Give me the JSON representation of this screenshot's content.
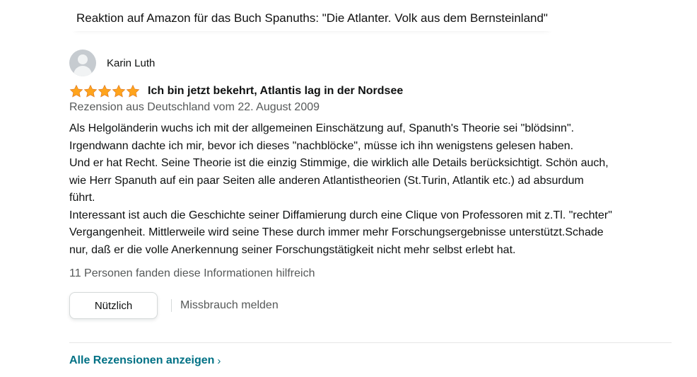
{
  "header": {
    "caption": "Reaktion auf Amazon für das Buch Spanuths: \"Die Atlanter. Volk aus dem Bernsteinland\""
  },
  "review": {
    "author": "Karin Luth",
    "rating": 5,
    "rating_max": 5,
    "star_color": "#ffa41c",
    "title": "Ich bin jetzt bekehrt, Atlantis lag in der Nordsee",
    "date_line": "Rezension aus Deutschland vom 22. August 2009",
    "body_lines": [
      "Als Helgoländerin wuchs ich mit der allgemeinen Einschätzung auf, Spanuth's Theorie sei \"blödsinn\".",
      "Irgendwann dachte ich mir, bevor ich dieses \"nachblöcke\", müsse ich ihn wenigstens gelesen haben.",
      "Und er hat Recht. Seine Theorie ist die einzig Stimmige, die wirklich alle Details berücksichtigt. Schön auch,",
      "wie Herr Spanuth auf ein paar Seiten alle anderen Atlantistheorien (St.Turin, Atlantik etc.) ad absurdum",
      "führt.",
      "Interessant ist auch die Geschichte seiner Diffamierung durch eine Clique von Professoren mit z.Tl. \"rechter\"",
      "Vergangenheit. Mittlerweile wird seine These durch immer mehr Forschungsergebnisse unterstützt.Schade",
      "nur, daß er die volle Anerkennung seiner Forschungstätigkeit nicht mehr selbst erlebt hat."
    ],
    "helpful_text": "11 Personen fanden diese Informationen hilfreich",
    "useful_button": "Nützlich",
    "report_link": "Missbrauch melden"
  },
  "footer": {
    "all_reviews_link": "Alle Rezensionen anzeigen",
    "link_color": "#007185"
  }
}
